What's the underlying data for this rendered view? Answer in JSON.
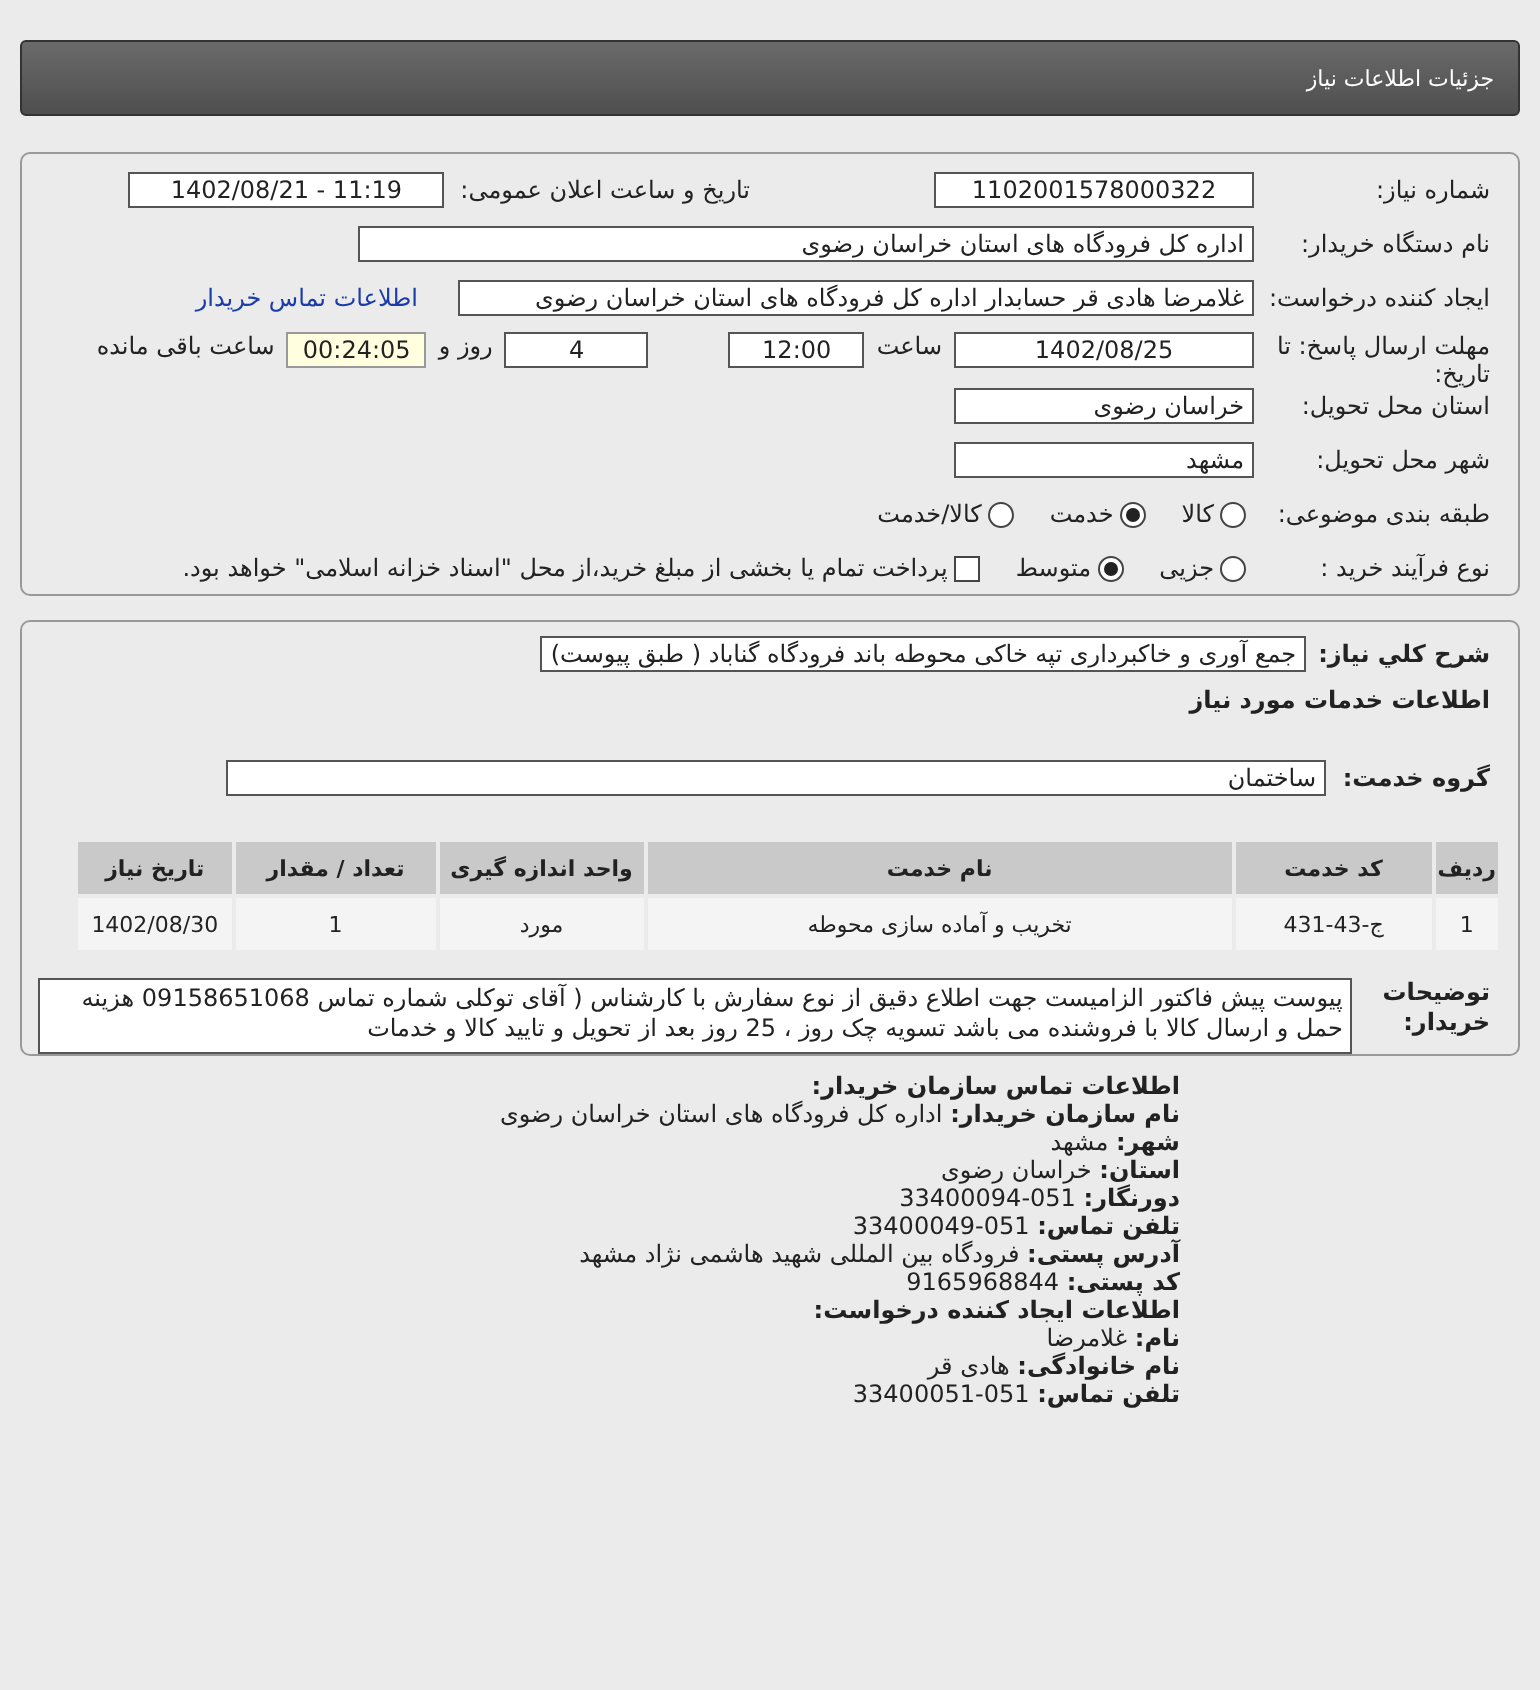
{
  "header": {
    "title": "جزئیات اطلاعات نیاز"
  },
  "need_number": {
    "label": "شماره نیاز:",
    "value": "1102001578000322"
  },
  "announce": {
    "label": "تاریخ و ساعت اعلان عمومی:",
    "value": "1402/08/21 - 11:19"
  },
  "buyer_org": {
    "label": "نام دستگاه خریدار:",
    "value": "اداره کل فرودگاه های استان خراسان رضوی"
  },
  "requester": {
    "label": "ایجاد کننده درخواست:",
    "value": "غلامرضا هادی قر حسابدار اداره کل فرودگاه های استان خراسان رضوی",
    "link": "اطلاعات تماس خریدار"
  },
  "deadline": {
    "label": "مهلت ارسال پاسخ: تا تاریخ:",
    "date": "1402/08/25",
    "time_label": "ساعت",
    "time": "12:00",
    "days": "4",
    "days_label": "روز و",
    "remaining": "00:24:05",
    "remaining_label": "ساعت باقی مانده"
  },
  "province": {
    "label": "استان محل تحویل:",
    "value": "خراسان رضوی"
  },
  "city": {
    "label": "شهر محل تحویل:",
    "value": "مشهد"
  },
  "category": {
    "label": "طبقه بندی موضوعی:",
    "options": [
      {
        "label": "کالا",
        "selected": false
      },
      {
        "label": "خدمت",
        "selected": true
      },
      {
        "label": "کالا/خدمت",
        "selected": false
      }
    ]
  },
  "process": {
    "label": "نوع فرآیند خرید :",
    "options": [
      {
        "label": "جزیی",
        "selected": false
      },
      {
        "label": "متوسط",
        "selected": true
      }
    ],
    "payment": {
      "label": "پرداخت تمام یا بخشی از مبلغ خرید،از محل \"اسناد خزانه اسلامی\" خواهد بود.",
      "checked": false
    }
  },
  "description": {
    "label": "شرح کلي نیاز:",
    "value": "جمع آوری و خاکبرداری تپه خاکی محوطه باند فرودگاه گناباد ( طبق پیوست)"
  },
  "services_title": "اطلاعات خدمات مورد نیاز",
  "service_group": {
    "label": "گروه خدمت:",
    "value": "ساختمان"
  },
  "table": {
    "columns": [
      "ردیف",
      "کد خدمت",
      "نام خدمت",
      "واحد اندازه گیری",
      "تعداد / مقدار",
      "تاریخ نیاز"
    ],
    "rows": [
      [
        "1",
        "ج-43-431",
        "تخریب و آماده سازی محوطه",
        "مورد",
        "1",
        "1402/08/30"
      ]
    ]
  },
  "buyer_notes": {
    "label": "توضیحات خریدار:",
    "value": "پیوست پیش فاکتور الزامیست جهت اطلاع دقیق از نوع سفارش با کارشناس ( آقای توکلی شماره تماس 09158651068 هزینه حمل و ارسال کالا با فروشنده می باشد تسویه چک روز ، 25 روز بعد از تحویل و تایید کالا و خدمات"
  },
  "contact": [
    {
      "kind": "heading",
      "text": "اطلاعات تماس سازمان خریدار:"
    },
    {
      "kind": "field",
      "label": "نام سازمان خریدار:",
      "value": "اداره کل فرودگاه های استان خراسان رضوی"
    },
    {
      "kind": "field",
      "label": "شهر:",
      "value": "مشهد"
    },
    {
      "kind": "field",
      "label": "استان:",
      "value": "خراسان رضوی"
    },
    {
      "kind": "field",
      "label": "دورنگار:",
      "value": "051-33400094"
    },
    {
      "kind": "field",
      "label": "تلفن تماس:",
      "value": "051-33400049"
    },
    {
      "kind": "field",
      "label": "آدرس پستی:",
      "value": "فرودگاه بین المللی شهید هاشمی نژاد مشهد"
    },
    {
      "kind": "field",
      "label": "کد پستی:",
      "value": "9165968844"
    },
    {
      "kind": "heading",
      "text": "اطلاعات ایجاد کننده درخواست:"
    },
    {
      "kind": "field",
      "label": "نام:",
      "value": "غلامرضا"
    },
    {
      "kind": "field",
      "label": "نام خانوادگی:",
      "value": "هادی قر"
    },
    {
      "kind": "field",
      "label": "تلفن تماس:",
      "value": "051-33400051"
    }
  ]
}
